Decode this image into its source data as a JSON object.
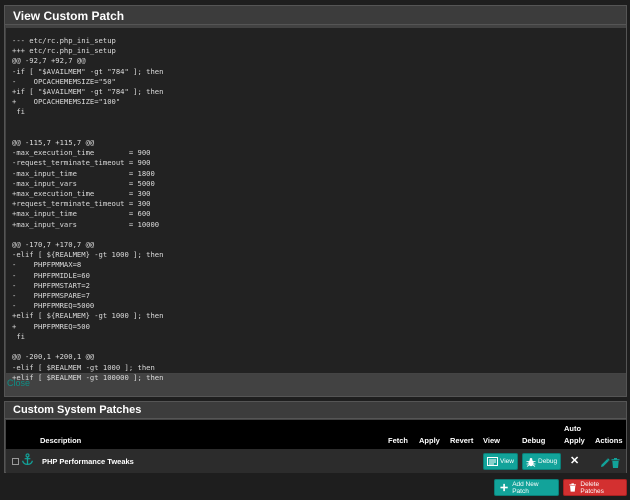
{
  "view_patch": {
    "title": "View Custom Patch",
    "diff": "--- etc/rc.php_ini_setup\n+++ etc/rc.php_ini_setup\n@@ -92,7 +92,7 @@\n-if [ \"$AVAILMEM\" -gt \"784\" ]; then\n-    OPCACHEMEMSIZE=\"50\"\n+if [ \"$AVAILMEM\" -gt \"784\" ]; then\n+    OPCACHEMEMSIZE=\"100\"\n fi\n\n\n@@ -115,7 +115,7 @@\n-max_execution_time        = 900\n-request_terminate_timeout = 900\n-max_input_time            = 1800\n-max_input_vars            = 5000\n+max_execution_time        = 300\n+request_terminate_timeout = 300\n+max_input_time            = 600\n+max_input_vars            = 10000\n\n@@ -170,7 +170,7 @@\n-elif [ ${REALMEM} -gt 1000 ]; then\n-    PHPFPMMAX=8\n-    PHPFPMIDLE=60\n-    PHPFPMSTART=2\n-    PHPFPMSPARE=7\n-    PHPFPMREQ=5000\n+elif [ ${REALMEM} -gt 1000 ]; then\n+    PHPFPMREQ=500\n fi\n\n@@ -200,1 +200,1 @@\n-elif [ $REALMEM -gt 1000 ]; then\n+elif [ $REALMEM -gt 100000 ]; then",
    "close_label": "Close"
  },
  "patches": {
    "title": "Custom System Patches",
    "columns": {
      "description": "Description",
      "fetch": "Fetch",
      "apply": "Apply",
      "revert": "Revert",
      "view": "View",
      "debug": "Debug",
      "auto_apply_1": "Auto",
      "auto_apply_2": "Apply",
      "actions": "Actions"
    },
    "rows": [
      {
        "description": "PHP Performance Tweaks",
        "view_label": "View",
        "debug_label": "Debug",
        "auto_apply_mark": "✕"
      }
    ],
    "add_label": "Add New Patch",
    "delete_label": "Delete Patches"
  },
  "colors": {
    "accent_teal": "#12a39a",
    "danger_red": "#d33030",
    "panel_bg": "#424242",
    "code_bg": "#222222"
  },
  "icons": [
    "anchor-icon",
    "list-icon",
    "bug-icon",
    "pencil-icon",
    "trash-icon",
    "plus-icon"
  ]
}
